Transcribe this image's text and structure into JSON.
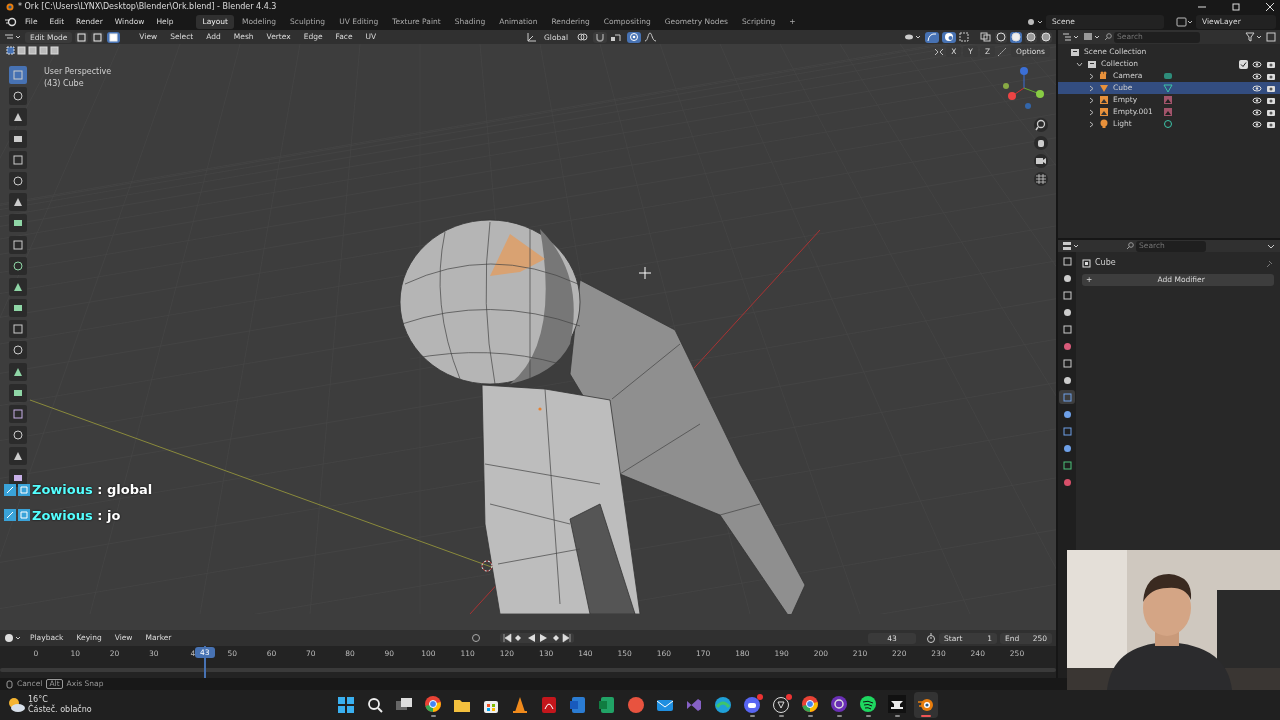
{
  "title_bar": {
    "title": "* Ork [C:\\Users\\LYNX\\Desktop\\Blender\\Ork.blend] - Blender 4.4.3"
  },
  "menus": [
    "File",
    "Edit",
    "Render",
    "Window",
    "Help"
  ],
  "workspaces": [
    {
      "label": "Layout",
      "selected": true
    },
    {
      "label": "Modeling",
      "selected": false
    },
    {
      "label": "Sculpting",
      "selected": false
    },
    {
      "label": "UV Editing",
      "selected": false
    },
    {
      "label": "Texture Paint",
      "selected": false
    },
    {
      "label": "Shading",
      "selected": false
    },
    {
      "label": "Animation",
      "selected": false
    },
    {
      "label": "Rendering",
      "selected": false
    },
    {
      "label": "Compositing",
      "selected": false
    },
    {
      "label": "Geometry Nodes",
      "selected": false
    },
    {
      "label": "Scripting",
      "selected": false
    },
    {
      "label": "+",
      "selected": false
    }
  ],
  "scene": "Scene",
  "view_layer": "ViewLayer",
  "viewport_header": {
    "mode": "Edit Mode",
    "select_modes": [
      {
        "selected": false
      },
      {
        "selected": false
      },
      {
        "selected": true
      }
    ],
    "menus": [
      "View",
      "Select",
      "Add",
      "Mesh",
      "Vertex",
      "Edge",
      "Face",
      "UV"
    ],
    "orientation": "Global",
    "snap_on": false,
    "proportional_on": true,
    "axes": [
      "X",
      "Y",
      "Z"
    ],
    "options": "Options"
  },
  "viewport": {
    "view_name": "User Perspective",
    "object_label": "(43) Cube"
  },
  "tools": [
    {
      "selected": true
    },
    {
      "selected": false
    },
    {
      "selected": false
    },
    {
      "selected": false
    },
    {
      "selected": false
    },
    {
      "selected": false
    },
    {
      "selected": false
    },
    {
      "selected": false
    },
    {
      "selected": false
    },
    {
      "selected": false
    },
    {
      "selected": false
    },
    {
      "selected": false
    },
    {
      "selected": false
    },
    {
      "selected": false
    },
    {
      "selected": false
    },
    {
      "selected": false
    },
    {
      "selected": false
    },
    {
      "selected": false
    },
    {
      "selected": false
    },
    {
      "selected": false
    }
  ],
  "chat": [
    {
      "user": "Zowious",
      "message": ": global"
    },
    {
      "user": "Zowious",
      "message": ": jo"
    }
  ],
  "outliner": {
    "search_placeholder": "Search",
    "root": "Scene Collection",
    "collection": {
      "label": "Collection",
      "expanded": true,
      "checked": true,
      "children": [
        {
          "label": "Camera",
          "kind": "camera",
          "selected": false
        },
        {
          "label": "Cube",
          "kind": "mesh",
          "selected": true
        },
        {
          "label": "Empty",
          "kind": "empty",
          "selected": false
        },
        {
          "label": "Empty.001",
          "kind": "empty",
          "selected": false
        },
        {
          "label": "Light",
          "kind": "light",
          "selected": false
        }
      ]
    }
  },
  "properties": {
    "search_placeholder": "Search",
    "object": "Cube",
    "add_modifier": "+",
    "add_modifier_label": "Add Modifier",
    "tabs": [
      {
        "selected": false
      },
      {
        "selected": false
      },
      {
        "selected": false
      },
      {
        "selected": false
      },
      {
        "selected": false
      },
      {
        "selected": false
      },
      {
        "selected": false
      },
      {
        "selected": false
      },
      {
        "selected": true
      },
      {
        "selected": false
      },
      {
        "selected": false
      },
      {
        "selected": false
      },
      {
        "selected": false
      },
      {
        "selected": false
      }
    ]
  },
  "timeline": {
    "menus": [
      "Playback",
      "Keying",
      "View",
      "Marker"
    ],
    "current_frame": "43",
    "start_label": "Start",
    "start": "1",
    "end_label": "End",
    "end": "250",
    "playhead_label": "43",
    "level": 0.172,
    "ticks": [
      "0",
      "10",
      "20",
      "30",
      "4",
      "50",
      "60",
      "70",
      "80",
      "90",
      "100",
      "110",
      "120",
      "130",
      "140",
      "150",
      "160",
      "170",
      "180",
      "190",
      "200",
      "210",
      "220",
      "230",
      "240",
      "250"
    ]
  },
  "status_bar": {
    "cancel": "Cancel",
    "key": "Alt",
    "hint": "Axis Snap"
  },
  "taskbar": {
    "temperature": "16°C",
    "weather": "Částeč. oblačno",
    "apps": [
      {
        "kind": "start",
        "running": false,
        "selected": false,
        "badge": false
      },
      {
        "kind": "search",
        "running": false,
        "selected": false,
        "badge": false
      },
      {
        "kind": "windows",
        "running": false,
        "selected": false,
        "badge": false
      },
      {
        "kind": "chrome",
        "running": true,
        "selected": false,
        "badge": false
      },
      {
        "kind": "folder",
        "running": false,
        "selected": false,
        "badge": false
      },
      {
        "kind": "store",
        "running": false,
        "selected": false,
        "badge": false
      },
      {
        "kind": "cone",
        "running": false,
        "selected": false,
        "badge": false
      },
      {
        "kind": "pdf",
        "running": false,
        "selected": false,
        "badge": false
      },
      {
        "kind": "word",
        "running": false,
        "selected": false,
        "badge": false
      },
      {
        "kind": "excel",
        "running": false,
        "selected": false,
        "badge": false
      },
      {
        "kind": "slides",
        "running": false,
        "selected": false,
        "badge": false
      },
      {
        "kind": "mail",
        "running": false,
        "selected": false,
        "badge": false
      },
      {
        "kind": "code",
        "running": false,
        "selected": false,
        "badge": false
      },
      {
        "kind": "wave",
        "running": false,
        "selected": false,
        "badge": false
      },
      {
        "kind": "chat",
        "running": true,
        "selected": false,
        "badge": true
      },
      {
        "kind": "record",
        "running": true,
        "selected": false,
        "badge": true
      },
      {
        "kind": "chrome",
        "running": true,
        "selected": false,
        "badge": false
      },
      {
        "kind": "ring",
        "running": true,
        "selected": false,
        "badge": false
      },
      {
        "kind": "music",
        "running": true,
        "selected": false,
        "badge": false
      },
      {
        "kind": "anvil",
        "running": true,
        "selected": false,
        "badge": false
      },
      {
        "kind": "blender",
        "running": true,
        "selected": true,
        "badge": false
      }
    ]
  }
}
